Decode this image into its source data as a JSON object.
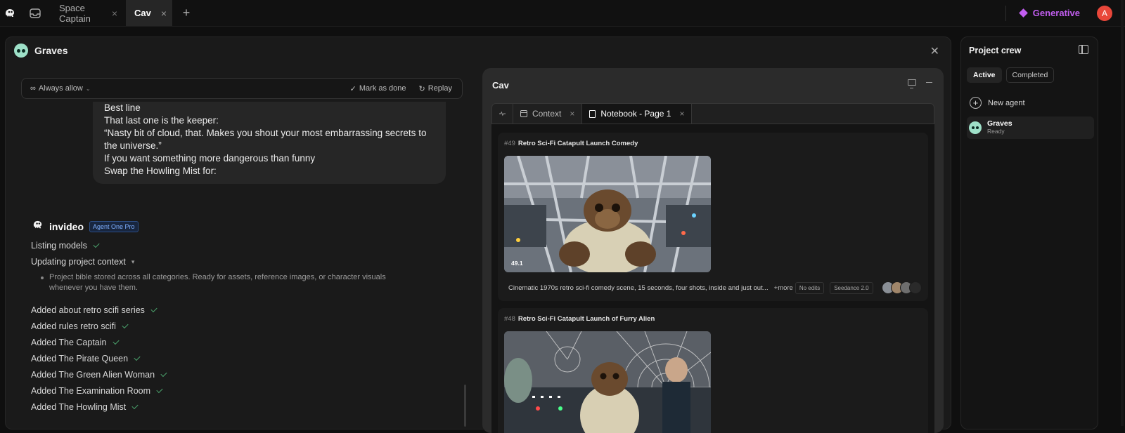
{
  "topbar": {
    "tabs": [
      {
        "label": "Space Captain",
        "active": false
      },
      {
        "label": "Cav",
        "active": true
      }
    ],
    "plan_label": "Generative",
    "user_initial": "A",
    "colors": {
      "plan": "#c25ef0",
      "avatar": "#e9473a"
    }
  },
  "chat": {
    "title": "Graves",
    "permission": {
      "label": "Always allow",
      "mark_done": "Mark as done",
      "replay": "Replay"
    },
    "message_lines": [
      "Best line",
      "That last one is the keeper:",
      "“Nasty bit of cloud, that. Makes you shout your most embarrassing secrets to",
      "the universe.”",
      "If you want something more dangerous than funny",
      "Swap the Howling Mist for:"
    ],
    "agent": {
      "name": "invideo",
      "badge": "Agent One Pro"
    },
    "steps": [
      {
        "label": "Listing models",
        "done": true
      },
      {
        "label": "Updating project context",
        "expandable": true
      },
      {
        "label": "Added about retro scifi series",
        "done": true
      },
      {
        "label": "Added rules retro scifi",
        "done": true
      },
      {
        "label": "Added The Captain",
        "done": true
      },
      {
        "label": "Added The Pirate Queen",
        "done": true
      },
      {
        "label": "Added The Green Alien Woman",
        "done": true
      },
      {
        "label": "Added The Examination Room",
        "done": true
      },
      {
        "label": "Added The Howling Mist",
        "done": true
      }
    ],
    "context_detail": "Project bible stored across all categories. Ready for assets, reference images, or character visuals whenever you have them."
  },
  "cav": {
    "title": "Cav",
    "tabs": [
      {
        "label": "Context"
      },
      {
        "label": "Notebook - Page 1",
        "active": true
      }
    ],
    "cards": [
      {
        "number": "#49",
        "title": "Retro Sci-Fi Catapult Launch Comedy",
        "duration": "49.1",
        "description": "Cinematic 1970s retro sci-fi comedy scene, 15 seconds, four shots, inside and just out...",
        "more": "+more",
        "chips": [
          "No edits",
          "Seedance 2.0"
        ]
      },
      {
        "number": "#48",
        "title": "Retro Sci-Fi Catapult Launch of Furry Alien"
      }
    ]
  },
  "crew": {
    "title": "Project crew",
    "tabs": [
      "Active",
      "Completed"
    ],
    "new_agent_label": "New agent",
    "agents": [
      {
        "name": "Graves",
        "status": "Ready"
      }
    ]
  }
}
